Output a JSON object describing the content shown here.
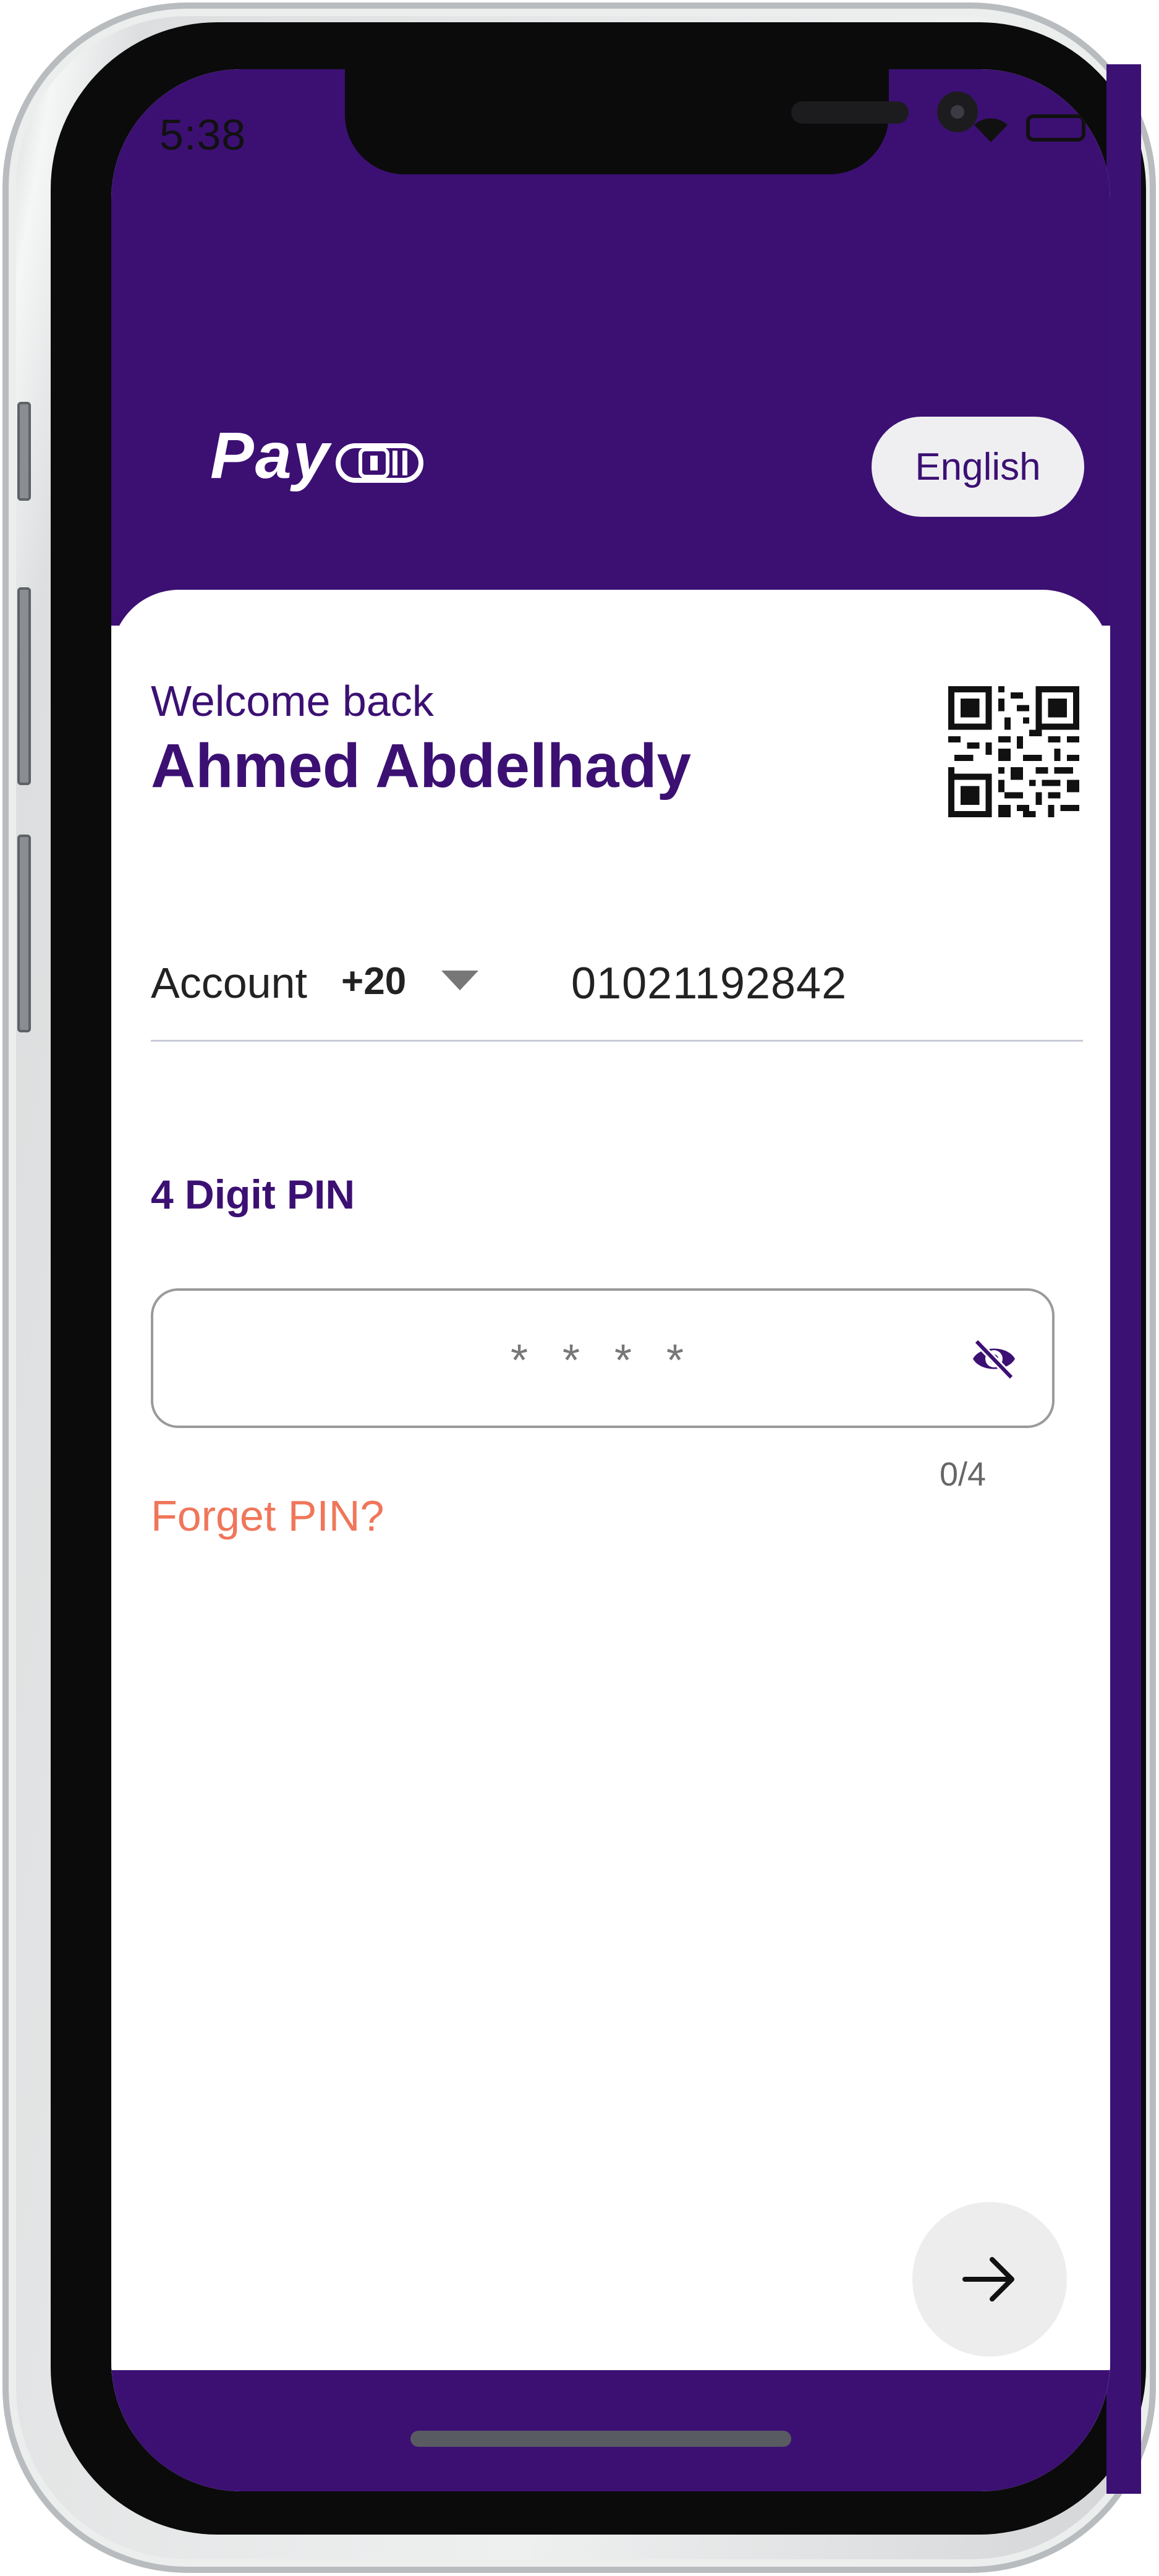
{
  "status_bar": {
    "time": "5:38"
  },
  "header": {
    "logo_text": "Pay",
    "language_button": "English"
  },
  "welcome": {
    "greeting": "Welcome back",
    "user_name": "Ahmed Abdelhady"
  },
  "account": {
    "label": "Account",
    "country_code": "+20",
    "phone_number": "01021192842"
  },
  "pin": {
    "title": "4 Digit PIN",
    "placeholder": "* * * *",
    "counter": "0/4",
    "forget_link": "Forget PIN?"
  },
  "colors": {
    "brand": "#3c1073",
    "accent": "#f0765a",
    "background": "#ffffff"
  },
  "icons": [
    "wifi-icon",
    "battery-icon",
    "qr-code-icon",
    "eye-off-icon",
    "dropdown-caret-icon",
    "arrow-right-icon",
    "coin-icon"
  ]
}
